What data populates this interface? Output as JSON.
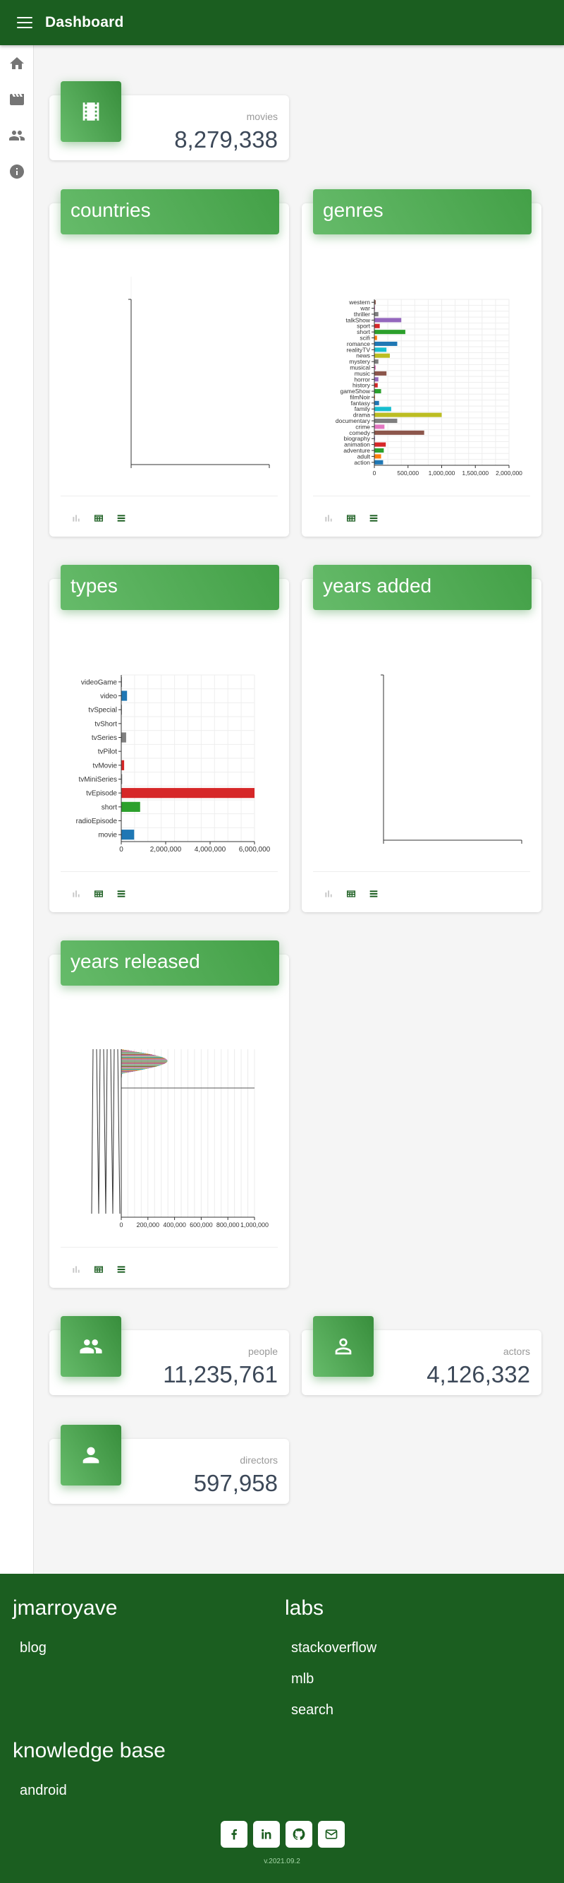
{
  "app": {
    "title": "Dashboard"
  },
  "siderail": {
    "items": [
      "home-icon",
      "movie-icon",
      "people-icon",
      "info-icon"
    ]
  },
  "stats": {
    "movies": {
      "label": "movies",
      "value": "8,279,338"
    },
    "people": {
      "label": "people",
      "value": "11,235,761"
    },
    "actors": {
      "label": "actors",
      "value": "4,126,332"
    },
    "directors": {
      "label": "directors",
      "value": "597,958"
    }
  },
  "charts": {
    "countries": {
      "title": "countries"
    },
    "genres": {
      "title": "genres"
    },
    "types": {
      "title": "types"
    },
    "years_added": {
      "title": "years added"
    },
    "years_released": {
      "title": "years released"
    }
  },
  "chart_data": [
    {
      "type": "bar",
      "orientation": "horizontal",
      "title": "genres",
      "categories": [
        "western",
        "war",
        "thriller",
        "talkShow",
        "sport",
        "short",
        "scifi",
        "romance",
        "realityTV",
        "news",
        "mystery",
        "musical",
        "music",
        "horror",
        "history",
        "gameShow",
        "filmNoir",
        "fantasy",
        "family",
        "drama",
        "documentary",
        "crime",
        "comedy",
        "biography",
        "animation",
        "adventure",
        "adult",
        "action"
      ],
      "values": [
        20000,
        10000,
        60000,
        400000,
        80000,
        460000,
        40000,
        340000,
        180000,
        230000,
        60000,
        20000,
        180000,
        60000,
        50000,
        100000,
        10000,
        70000,
        250000,
        1000000,
        340000,
        150000,
        740000,
        10000,
        170000,
        140000,
        100000,
        130000
      ],
      "colors": [
        "#8c564b",
        "#e377c2",
        "#7f7f7f",
        "#9467bd",
        "#d62728",
        "#2ca02c",
        "#ff7f0e",
        "#1f77b4",
        "#17becf",
        "#bcbd22",
        "#7f7f7f",
        "#e377c2",
        "#8c564b",
        "#9467bd",
        "#d62728",
        "#2ca02c",
        "#ff7f0e",
        "#1f77b4",
        "#17becf",
        "#bcbd22",
        "#7f7f7f",
        "#e377c2",
        "#8c564b",
        "#9467bd",
        "#d62728",
        "#2ca02c",
        "#ff7f0e",
        "#1f77b4"
      ],
      "xticks": [
        "0",
        "500,000",
        "1,000,000",
        "1,500,000",
        "2,000,000"
      ],
      "xlim": [
        0,
        2000000
      ],
      "grid": true
    },
    {
      "type": "bar",
      "orientation": "horizontal",
      "title": "types",
      "categories": [
        "videoGame",
        "video",
        "tvSpecial",
        "tvShort",
        "tvSeries",
        "tvPilot",
        "tvMovie",
        "tvMiniSeries",
        "tvEpisode",
        "short",
        "radioEpisode",
        "movie"
      ],
      "values": [
        30000,
        260000,
        30000,
        10000,
        220000,
        1000,
        130000,
        40000,
        6000000,
        850000,
        100,
        580000
      ],
      "colors": [
        "#7f7f7f",
        "#1f77b4",
        "#7f7f7f",
        "#7f7f7f",
        "#7f7f7f",
        "#7f7f7f",
        "#d62728",
        "#7f7f7f",
        "#d62728",
        "#2ca02c",
        "#7f7f7f",
        "#1f77b4"
      ],
      "xticks": [
        "0",
        "2,000,000",
        "4,000,000",
        "6,000,000"
      ],
      "xlim": [
        0,
        6000000
      ],
      "grid": true
    },
    {
      "type": "bar",
      "orientation": "horizontal",
      "title": "years released",
      "xticks": [
        "0",
        "200,000",
        "400,000",
        "600,000",
        "800,000",
        "1,000,000"
      ],
      "xlim": [
        0,
        1000000
      ],
      "grid": true
    }
  ],
  "footer": {
    "jmarroyave": {
      "title": "jmarroyave",
      "links": [
        "blog"
      ]
    },
    "labs": {
      "title": "labs",
      "links": [
        "stackoverflow",
        "mlb",
        "search"
      ]
    },
    "knowledge": {
      "title": "knowledge base",
      "links": [
        "android"
      ]
    },
    "version": "v.2021.09.2"
  }
}
